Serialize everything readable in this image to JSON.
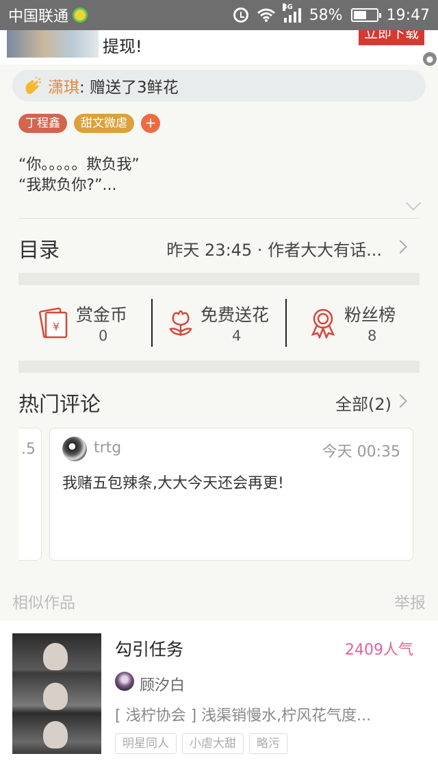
{
  "status_bar": {
    "carrier": "中国联通",
    "network": "3G",
    "battery": "58%",
    "battery_level": 0.58,
    "time": "19:47"
  },
  "ad": {
    "text": "提现!",
    "button": "立即下载"
  },
  "gift": {
    "name": "潇琪",
    "text": ": 赠送了3鲜花"
  },
  "tags": [
    "丁程鑫",
    "甜文微虐"
  ],
  "tag_add": "+",
  "summary": {
    "line1": "“你。。。。。欺负我”",
    "line2": "“我欺负你?”..."
  },
  "catalog": {
    "title": "目录",
    "latest": "昨天 23:45 · 作者大大有话..."
  },
  "stats": [
    {
      "label": "赏金币",
      "value": "0",
      "icon": "red-envelope-icon"
    },
    {
      "label": "免费送花",
      "value": "4",
      "icon": "flower-icon"
    },
    {
      "label": "粉丝榜",
      "value": "8",
      "icon": "medal-icon"
    }
  ],
  "hot_comments": {
    "title": "热门评论",
    "all": "全部(2)",
    "prev_fragment": ".5",
    "comment": {
      "user": "trtg",
      "time": "今天 00:35",
      "text": "我赌五包辣条,大大今天还会再更!"
    }
  },
  "similar": {
    "label": "相似作品",
    "report": "举报"
  },
  "book": {
    "title": "勾引任务",
    "popularity": "2409人气",
    "author": "顾汐白",
    "description": "[ 浅柠协会 ] 浅渠销慢水,柠风花气度...",
    "tags": [
      "明星同人",
      "小虐大甜",
      "略污"
    ]
  },
  "colors": {
    "accent_orange": "#e0893f",
    "icon_red": "#d7463a",
    "popularity_pink": "#e2619a"
  }
}
